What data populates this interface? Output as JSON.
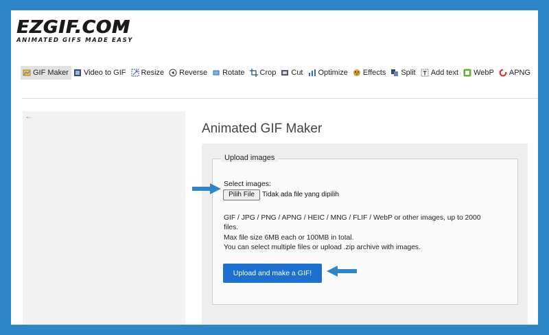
{
  "logo": {
    "main": "EZGIF.COM",
    "tagline": "ANIMATED GIFS MADE EASY"
  },
  "nav": {
    "items": [
      {
        "label": "GIF Maker",
        "icon": "gif-maker-icon",
        "active": true
      },
      {
        "label": "Video to GIF",
        "icon": "film-icon"
      },
      {
        "label": "Resize",
        "icon": "resize-icon"
      },
      {
        "label": "Reverse",
        "icon": "reverse-icon"
      },
      {
        "label": "Rotate",
        "icon": "rotate-icon"
      },
      {
        "label": "Crop",
        "icon": "crop-icon"
      },
      {
        "label": "Cut",
        "icon": "cut-icon"
      },
      {
        "label": "Optimize",
        "icon": "optimize-icon"
      },
      {
        "label": "Effects",
        "icon": "effects-icon"
      },
      {
        "label": "Split",
        "icon": "split-icon"
      },
      {
        "label": "Add text",
        "icon": "add-text-icon"
      },
      {
        "label": "WebP",
        "icon": "webp-icon"
      },
      {
        "label": "APNG",
        "icon": "apng-icon"
      }
    ]
  },
  "page": {
    "title": "Animated GIF Maker"
  },
  "upload": {
    "legend": "Upload images",
    "select_label": "Select images:",
    "file_button": "Pilih File",
    "file_status": "Tidak ada file yang dipilih",
    "info": [
      "GIF / JPG / PNG / APNG / HEIC / MNG / FLIF / WebP or other images, up to 2000",
      "files.",
      "Max file size 6MB each or 100MB in total.",
      "You can select multiple files or upload .zip archive with images."
    ],
    "submit": "Upload and make a GIF!"
  },
  "colors": {
    "frame": "#2E86C8",
    "primary_button": "#1d6fd0",
    "arrow": "#2E86C8"
  }
}
